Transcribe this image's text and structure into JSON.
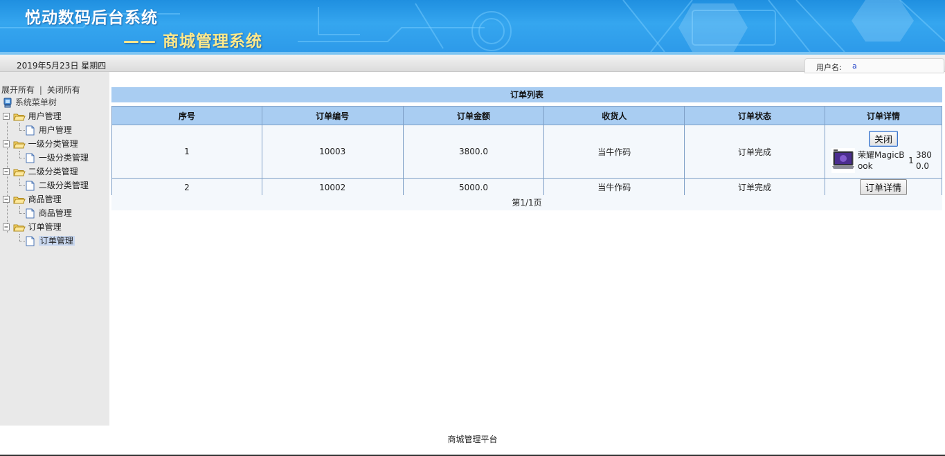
{
  "header": {
    "title": "悦动数码后台系统",
    "subtitle": "—— 商城管理系统"
  },
  "infobar": {
    "date": "2019年5月23日 星期四",
    "user_label": "用户名:",
    "user_value": "a"
  },
  "sidebar": {
    "expand_all": "展开所有",
    "separator": "|",
    "collapse_all": "关闭所有",
    "root": "系统菜单树",
    "groups": [
      {
        "label": "用户管理",
        "child": "用户管理"
      },
      {
        "label": "一级分类管理",
        "child": "一级分类管理"
      },
      {
        "label": "二级分类管理",
        "child": "二级分类管理"
      },
      {
        "label": "商品管理",
        "child": "商品管理"
      },
      {
        "label": "订单管理",
        "child": "订单管理"
      }
    ],
    "selected_item": "订单管理"
  },
  "main": {
    "list_title": "订单列表",
    "columns": [
      "序号",
      "订单编号",
      "订单金额",
      "收货人",
      "订单状态",
      "订单详情"
    ],
    "rows": [
      {
        "index": "1",
        "order_no": "10003",
        "amount": "3800.0",
        "receiver": "当牛作码",
        "status": "订单完成",
        "button": "关闭",
        "detail": {
          "product": "荣耀MagicBook",
          "qty": "1",
          "price": "3800.0"
        }
      },
      {
        "index": "2",
        "order_no": "10002",
        "amount": "5000.0",
        "receiver": "当牛作码",
        "status": "订单完成",
        "button": "订单详情"
      }
    ],
    "pager": "第1/1页"
  },
  "footer": {
    "text": "商城管理平台"
  },
  "colors": {
    "banner": "#2d9ae9",
    "table_header": "#a9cdf2",
    "sidebar_bg": "#e9e9e9",
    "subtitle": "#ffe98a"
  }
}
